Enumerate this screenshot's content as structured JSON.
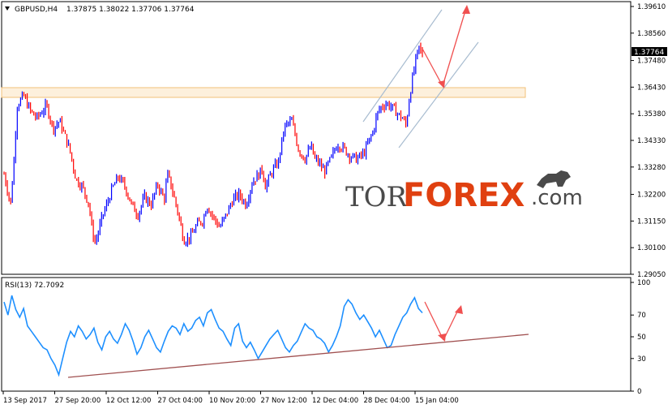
{
  "chart_data": [
    {
      "type": "candlestick",
      "symbol_header": "GBPUSD,H4",
      "ohlc_header": "1.37875 1.38022 1.37706 1.37764",
      "current_price_label": "1.37764",
      "y_ticks": [
        "1.39610",
        "1.38560",
        "1.37480",
        "1.36430",
        "1.35380",
        "1.34330",
        "1.33280",
        "1.32200",
        "1.31150",
        "1.30100",
        "1.29050"
      ],
      "ylim": [
        1.2905,
        1.3961
      ],
      "x_ticks": [
        "13 Sep 2017",
        "27 Sep 20:00",
        "12 Oct 12:00",
        "27 Oct 04:00",
        "10 Nov 20:00",
        "27 Nov 12:00",
        "12 Dec 04:00",
        "28 Dec 04:00",
        "15 Jan 04:00"
      ],
      "close_path": [
        [
          0,
          1.33
        ],
        [
          2,
          1.318
        ],
        [
          3,
          1.335
        ],
        [
          4,
          1.357
        ],
        [
          6,
          1.361
        ],
        [
          8,
          1.355
        ],
        [
          10,
          1.352
        ],
        [
          13,
          1.357
        ],
        [
          15,
          1.348
        ],
        [
          17,
          1.351
        ],
        [
          20,
          1.34
        ],
        [
          22,
          1.328
        ],
        [
          24,
          1.325
        ],
        [
          26,
          1.318
        ],
        [
          27,
          1.307
        ],
        [
          28,
          1.303
        ],
        [
          30,
          1.313
        ],
        [
          32,
          1.32
        ],
        [
          33,
          1.324
        ],
        [
          35,
          1.329
        ],
        [
          37,
          1.325
        ],
        [
          39,
          1.318
        ],
        [
          41,
          1.314
        ],
        [
          43,
          1.321
        ],
        [
          45,
          1.318
        ],
        [
          47,
          1.326
        ],
        [
          49,
          1.32
        ],
        [
          50,
          1.33
        ],
        [
          51,
          1.326
        ],
        [
          53,
          1.316
        ],
        [
          55,
          1.304
        ],
        [
          57,
          1.305
        ],
        [
          59,
          1.31
        ],
        [
          61,
          1.312
        ],
        [
          62,
          1.318
        ],
        [
          64,
          1.313
        ],
        [
          66,
          1.309
        ],
        [
          68,
          1.314
        ],
        [
          70,
          1.32
        ],
        [
          72,
          1.322
        ],
        [
          74,
          1.318
        ],
        [
          76,
          1.327
        ],
        [
          78,
          1.33
        ],
        [
          79,
          1.332
        ],
        [
          80,
          1.325
        ],
        [
          82,
          1.331
        ],
        [
          84,
          1.335
        ],
        [
          85,
          1.343
        ],
        [
          86,
          1.349
        ],
        [
          88,
          1.351
        ],
        [
          89,
          1.346
        ],
        [
          90,
          1.34
        ],
        [
          92,
          1.336
        ],
        [
          94,
          1.341
        ],
        [
          95,
          1.336
        ],
        [
          96,
          1.335
        ],
        [
          98,
          1.331
        ],
        [
          100,
          1.336
        ],
        [
          102,
          1.342
        ],
        [
          104,
          1.34
        ],
        [
          106,
          1.337
        ],
        [
          108,
          1.336
        ],
        [
          110,
          1.338
        ],
        [
          112,
          1.344
        ],
        [
          113,
          1.347
        ],
        [
          114,
          1.353
        ],
        [
          115,
          1.356
        ],
        [
          117,
          1.358
        ],
        [
          119,
          1.356
        ],
        [
          121,
          1.353
        ],
        [
          122,
          1.352
        ],
        [
          123,
          1.349
        ],
        [
          124,
          1.36
        ],
        [
          125,
          1.368
        ],
        [
          126,
          1.375
        ],
        [
          127,
          1.38
        ],
        [
          128,
          1.377
        ]
      ]
    },
    {
      "type": "line",
      "indicator_label": "RSI(13) 72.7092",
      "y_ticks": [
        "100",
        "70",
        "50",
        "30",
        "0"
      ],
      "ylim": [
        0,
        100
      ],
      "series": [
        {
          "values": [
            82,
            70,
            88,
            75,
            68,
            76,
            60,
            55,
            50,
            45,
            40,
            38,
            30,
            24,
            15,
            30,
            45,
            55,
            50,
            60,
            55,
            48,
            52,
            58,
            45,
            38,
            50,
            55,
            48,
            44,
            52,
            62,
            56,
            46,
            34,
            40,
            50,
            56,
            48,
            40,
            36,
            46,
            55,
            60,
            58,
            52,
            62,
            55,
            58,
            65,
            68,
            60,
            72,
            75,
            66,
            58,
            55,
            48,
            42,
            58,
            62,
            46,
            40,
            45,
            38,
            30,
            36,
            42,
            48,
            52,
            56,
            48,
            40,
            36,
            42,
            46,
            54,
            62,
            58,
            56,
            50,
            48,
            44,
            36,
            42,
            50,
            60,
            78,
            84,
            80,
            72,
            66,
            70,
            64,
            58,
            50,
            56,
            48,
            40,
            42,
            52,
            60,
            68,
            72,
            80,
            86,
            76,
            72
          ]
        }
      ]
    }
  ],
  "watermark": {
    "tor": "TOR",
    "forex": "FOREX",
    "com": ".com"
  },
  "colors": {
    "bull": "#0000ff",
    "bear": "#ff0000",
    "rsi": "#1e90ff",
    "arrow": "#f05050",
    "channel": "#a8bcd0",
    "zone": "#f2c078",
    "trend": "#a05050"
  }
}
